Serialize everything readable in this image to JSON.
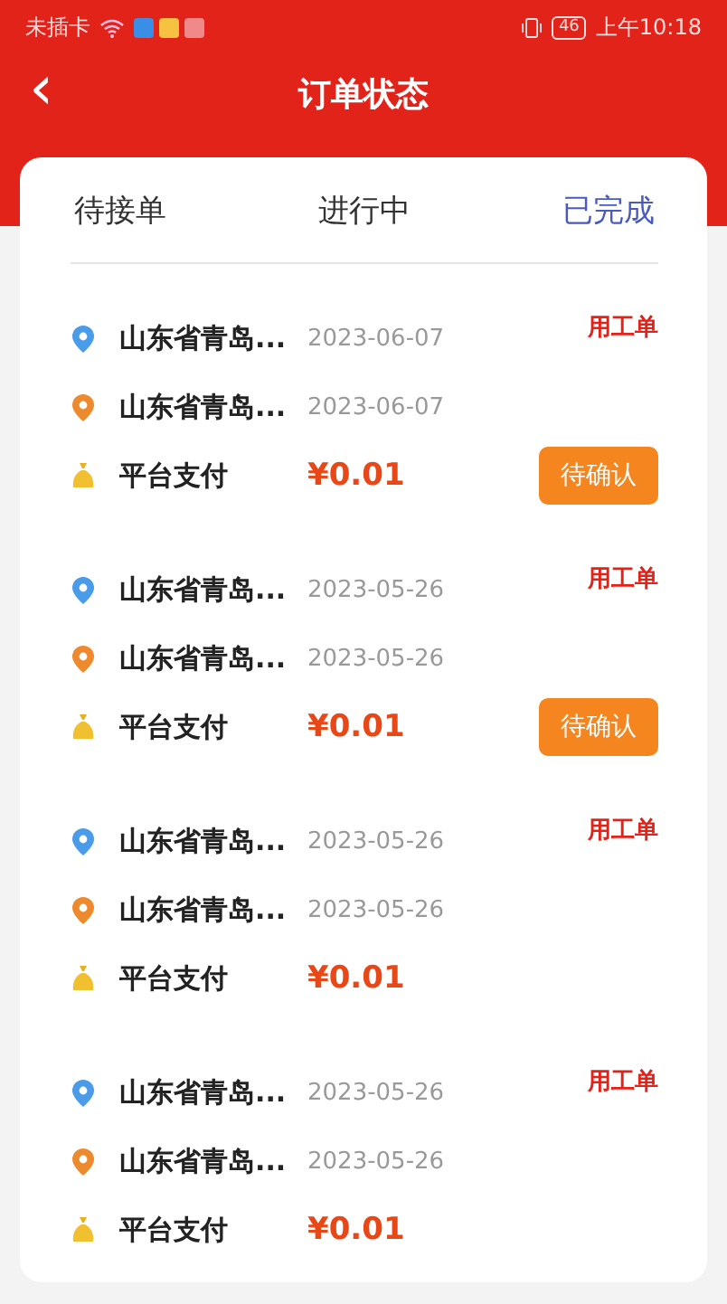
{
  "status_bar": {
    "carrier": "未插卡",
    "battery": "46",
    "time": "上午10:18"
  },
  "header": {
    "back": "‹",
    "title": "订单状态"
  },
  "tabs": [
    {
      "label": "待接单",
      "selected": false
    },
    {
      "label": "进行中",
      "selected": false
    },
    {
      "label": "已完成",
      "selected": true
    }
  ],
  "orders": [
    {
      "from": "山东省青岛...",
      "from_date": "2023-06-07",
      "to": "山东省青岛...",
      "to_date": "2023-06-07",
      "type": "用工单",
      "pay_label": "平台支付",
      "amount": "¥0.01",
      "action": "待确认"
    },
    {
      "from": "山东省青岛...",
      "from_date": "2023-05-26",
      "to": "山东省青岛...",
      "to_date": "2023-05-26",
      "type": "用工单",
      "pay_label": "平台支付",
      "amount": "¥0.01",
      "action": "待确认"
    },
    {
      "from": "山东省青岛...",
      "from_date": "2023-05-26",
      "to": "山东省青岛...",
      "to_date": "2023-05-26",
      "type": "用工单",
      "pay_label": "平台支付",
      "amount": "¥0.01"
    },
    {
      "from": "山东省青岛...",
      "from_date": "2023-05-26",
      "to": "山东省青岛...",
      "to_date": "2023-05-26",
      "type": "用工单",
      "pay_label": "平台支付",
      "amount": "¥0.01"
    }
  ]
}
